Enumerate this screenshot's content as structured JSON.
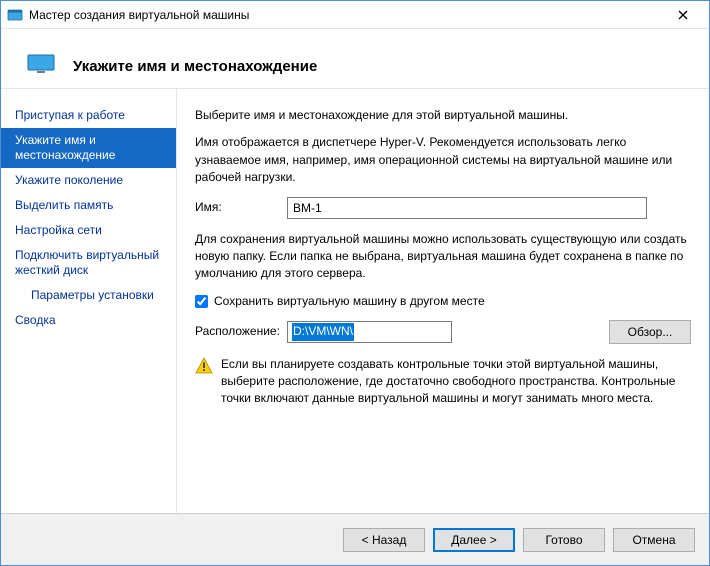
{
  "titlebar": {
    "title": "Мастер создания виртуальной машины"
  },
  "header": {
    "title": "Укажите имя и местонахождение"
  },
  "sidebar": {
    "items": [
      {
        "label": "Приступая к работе"
      },
      {
        "label": "Укажите имя и местонахождение"
      },
      {
        "label": "Укажите поколение"
      },
      {
        "label": "Выделить память"
      },
      {
        "label": "Настройка сети"
      },
      {
        "label": "Подключить виртуальный жесткий диск"
      },
      {
        "label": "Параметры установки"
      },
      {
        "label": "Сводка"
      }
    ]
  },
  "content": {
    "intro": "Выберите имя и местонахождение для этой виртуальной машины.",
    "name_hint": "Имя отображается в диспетчере Hyper-V. Рекомендуется использовать легко узнаваемое имя, например, имя операционной системы на виртуальной машине или рабочей нагрузки.",
    "name_label": "Имя:",
    "name_value": "ВМ-1",
    "folder_hint": "Для сохранения виртуальной машины можно использовать существующую или создать новую папку. Если папка не выбрана, виртуальная машина будет сохранена в папке по умолчанию для этого сервера.",
    "store_checkbox_label": "Сохранить виртуальную машину в другом месте",
    "store_checked": true,
    "location_label": "Расположение:",
    "location_value": "D:\\VM\\WN\\",
    "browse_label": "Обзор...",
    "warn_text": "Если вы планируете создавать контрольные точки этой виртуальной машины, выберите расположение, где достаточно свободного пространства. Контрольные точки включают данные виртуальной машины и могут занимать много места."
  },
  "footer": {
    "back": "< Назад",
    "next": "Далее >",
    "finish": "Готово",
    "cancel": "Отмена"
  }
}
